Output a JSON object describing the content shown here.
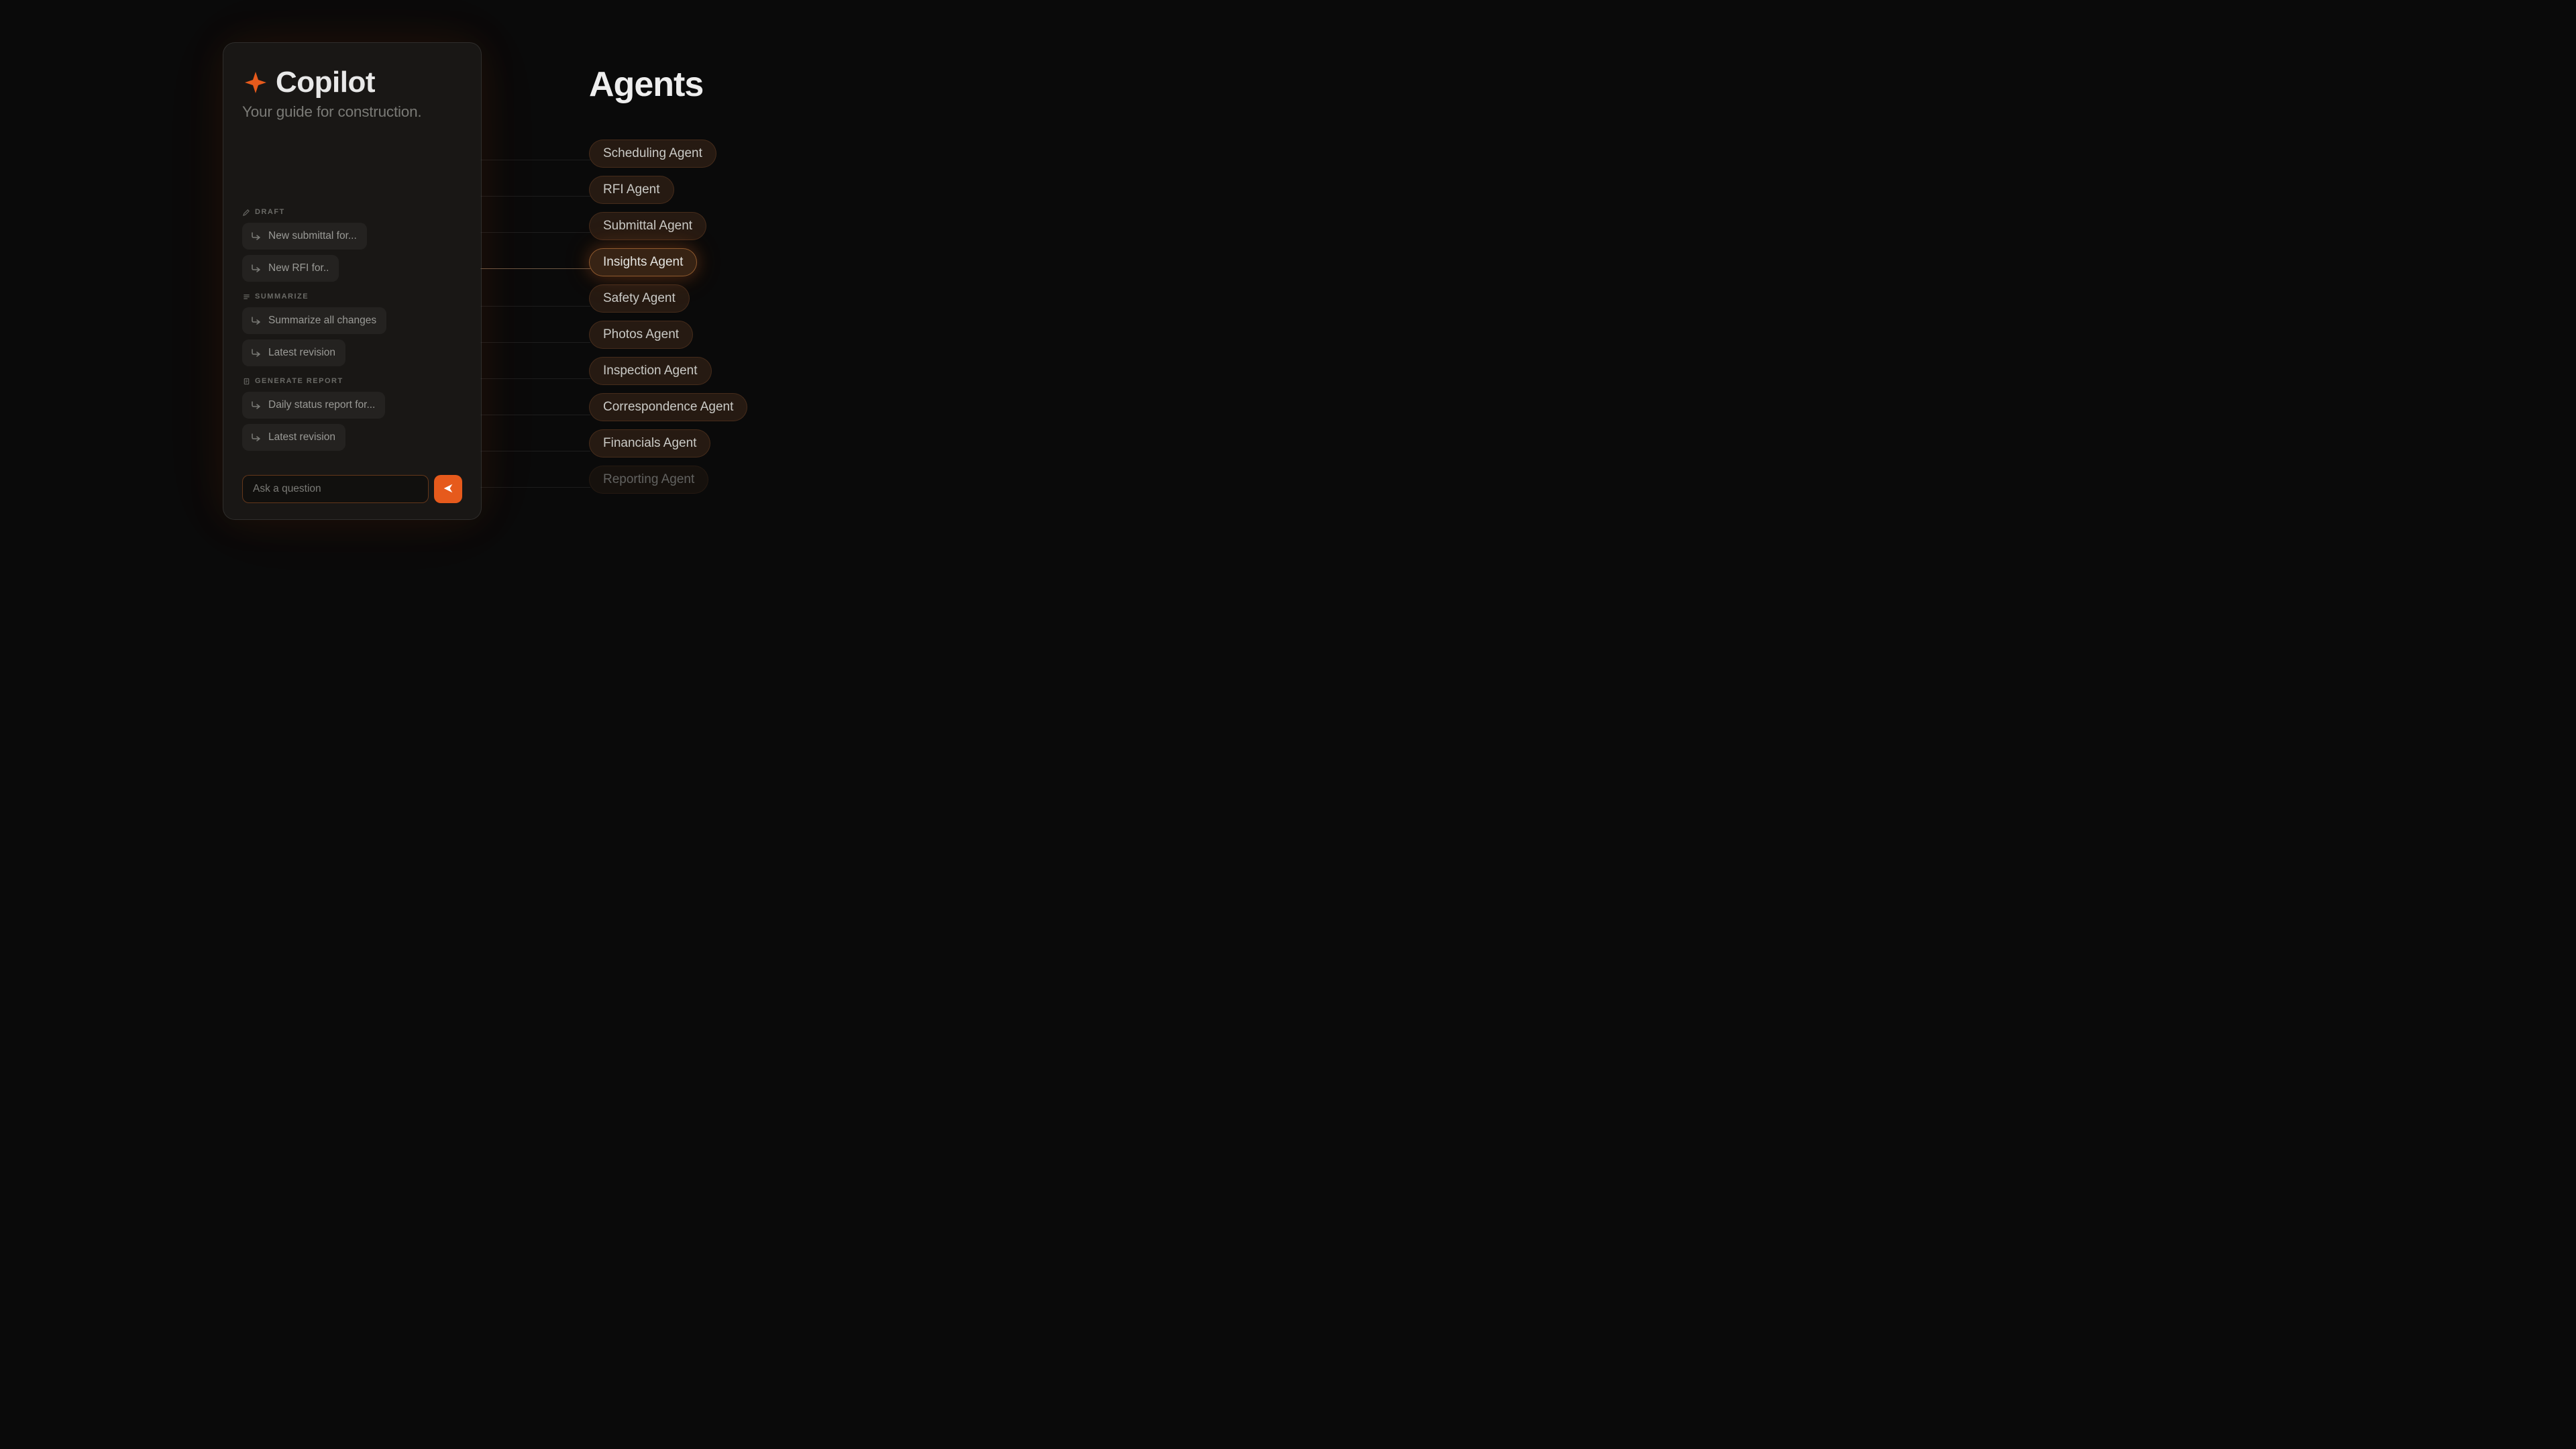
{
  "copilot": {
    "title": "Copilot",
    "subtitle": "Your guide for construction.",
    "sections": [
      {
        "label": "DRAFT",
        "chips": [
          "New submittal for...",
          "New RFI for.."
        ]
      },
      {
        "label": "SUMMARIZE",
        "chips": [
          "Summarize all changes",
          "Latest revision"
        ]
      },
      {
        "label": "GENERATE REPORT",
        "chips": [
          "Daily status report for...",
          "Latest revision"
        ]
      }
    ],
    "input_placeholder": "Ask a question"
  },
  "agents": {
    "title": "Agents",
    "items": [
      {
        "label": "Scheduling Agent",
        "highlighted": false,
        "faded": false
      },
      {
        "label": "RFI Agent",
        "highlighted": false,
        "faded": false
      },
      {
        "label": "Submittal Agent",
        "highlighted": false,
        "faded": false
      },
      {
        "label": "Insights Agent",
        "highlighted": true,
        "faded": false
      },
      {
        "label": "Safety Agent",
        "highlighted": false,
        "faded": false
      },
      {
        "label": "Photos Agent",
        "highlighted": false,
        "faded": false
      },
      {
        "label": "Inspection Agent",
        "highlighted": false,
        "faded": false
      },
      {
        "label": "Correspondence Agent",
        "highlighted": false,
        "faded": false
      },
      {
        "label": "Financials Agent",
        "highlighted": false,
        "faded": false
      },
      {
        "label": "Reporting Agent",
        "highlighted": false,
        "faded": true
      }
    ]
  }
}
